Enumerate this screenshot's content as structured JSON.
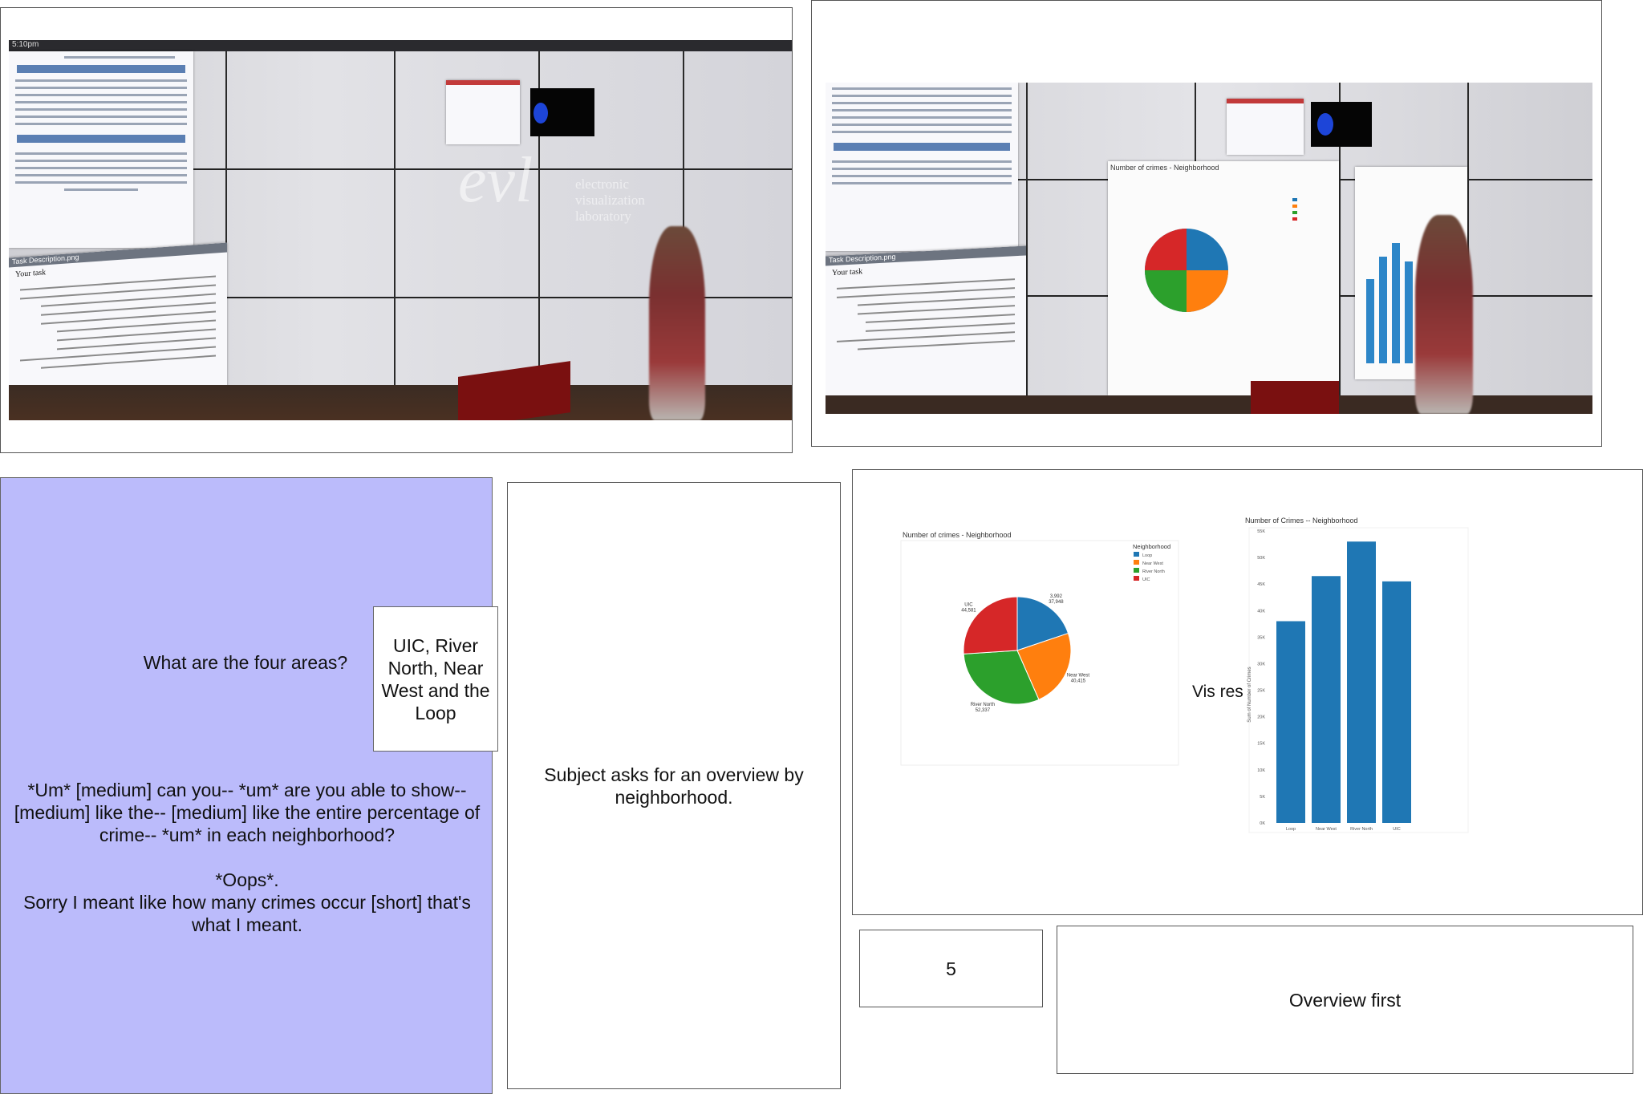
{
  "photo_left": {
    "wall_window_title": "Task Description.png",
    "doc_heading": "Your task",
    "logo_text": "evl",
    "logo_subtitle": "electronic visualization laboratory",
    "clock": "5:10pm"
  },
  "photo_right": {
    "wall_window_title": "Task Description.png",
    "doc_heading": "Your task",
    "chart_title": "Number of crimes - Neighborhood"
  },
  "question_box": {
    "question": "What are the four areas?",
    "answer": "UIC, River North, Near West and the Loop",
    "utterance": "*Um* [medium] can you-- *um* are you able to show-- [medium] like the-- [medium] like the entire percentage of crime-- *um* in each neighborhood?",
    "oops": "*Oops*.",
    "correction": "Sorry I meant like how many crimes occur [short] that's what I meant."
  },
  "description_box": {
    "text": "Subject asks for an overview by neighborhood."
  },
  "vis_panel": {
    "overlay_text": "Vis res"
  },
  "count_box": {
    "value": "5"
  },
  "principle_box": {
    "text": "Overview first"
  },
  "colors": {
    "blue": "#1f77b4",
    "orange": "#ff7f0e",
    "green": "#2ca02c",
    "red": "#d62728",
    "lavender": "#bbbbfb"
  },
  "chart_data": [
    {
      "type": "pie",
      "title": "Number of crimes - Neighborhood",
      "legend_title": "Neighborhood",
      "legend_position": "right",
      "categories": [
        "Loop",
        "Near West",
        "River North",
        "UIC"
      ],
      "values": [
        33948,
        40415,
        52337,
        44581
      ],
      "slice_labels": [
        "3,992\n37,948",
        "Near West\n40,415",
        "River North\n52,337",
        "UIC\n44,581"
      ],
      "colors": [
        "#1f77b4",
        "#ff7f0e",
        "#2ca02c",
        "#d62728"
      ]
    },
    {
      "type": "bar",
      "title": "Number of Crimes -- Neighborhood",
      "ylabel": "Sum of Number of Crimes",
      "xlabel": "",
      "categories": [
        "Loop",
        "Near West",
        "River North",
        "UIC"
      ],
      "values": [
        38000,
        46500,
        53000,
        45500
      ],
      "ylim": [
        0,
        55000
      ],
      "yticks": [
        "0K",
        "5K",
        "10K",
        "15K",
        "20K",
        "25K",
        "30K",
        "35K",
        "40K",
        "45K",
        "50K",
        "55K"
      ],
      "color": "#1f77b4",
      "grid": false
    }
  ]
}
